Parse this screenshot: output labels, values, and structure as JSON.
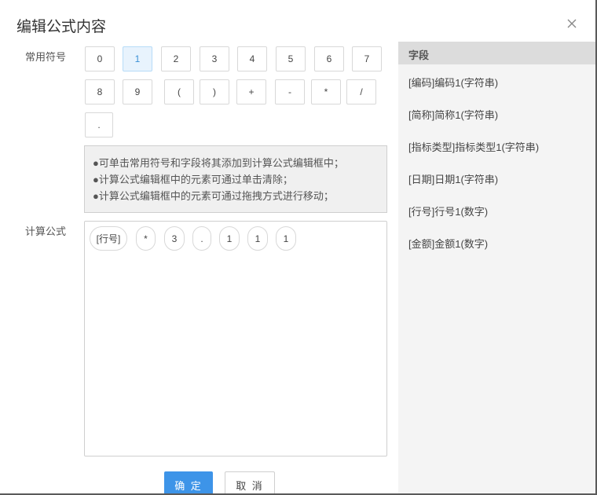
{
  "dialog": {
    "title": "编辑公式内容",
    "close_icon": "close-icon"
  },
  "symbols": {
    "label": "常用符号",
    "active_index": 1,
    "items": [
      "0",
      "1",
      "2",
      "3",
      "4",
      "5",
      "6",
      "7",
      "8",
      "9",
      "(",
      ")",
      "+",
      "-",
      "*",
      "/",
      "."
    ]
  },
  "tips": [
    "●可单击常用符号和字段将其添加到计算公式编辑框中；",
    "●计算公式编辑框中的元素可通过单击清除；",
    "●计算公式编辑框中的元素可通过拖拽方式进行移动；"
  ],
  "formula": {
    "label": "计算公式",
    "tokens": [
      "[行号]",
      "*",
      "3",
      ".",
      "1",
      "1",
      "1"
    ]
  },
  "fields": {
    "header": "字段",
    "items": [
      "[编码]编码1(字符串)",
      "[简称]简称1(字符串)",
      "[指标类型]指标类型1(字符串)",
      "[日期]日期1(字符串)",
      "[行号]行号1(数字)",
      "[金额]金额1(数字)"
    ]
  },
  "buttons": {
    "ok": "确 定",
    "cancel": "取 消"
  },
  "colors": {
    "primary": "#3d94e8",
    "active_symbol_bg": "#e8f3fd",
    "panel_bg": "#f4f4f4"
  }
}
